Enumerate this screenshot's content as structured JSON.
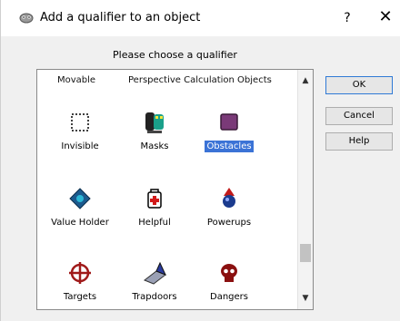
{
  "window": {
    "title": "Add a qualifier to an object",
    "help_glyph": "?",
    "close_glyph": "✕"
  },
  "prompt": "Please choose a qualifier",
  "list": {
    "headers": [
      "Movable",
      "Perspective Calculation Objects"
    ],
    "items": [
      {
        "label": "Invisible",
        "icon": "dotted-square-icon",
        "selected": false
      },
      {
        "label": "Masks",
        "icon": "masks-icon",
        "selected": false
      },
      {
        "label": "Obstacles",
        "icon": "obstacle-box-icon",
        "selected": true
      },
      {
        "label": "Value Holder",
        "icon": "value-holder-icon",
        "selected": false
      },
      {
        "label": "Helpful",
        "icon": "first-aid-icon",
        "selected": false
      },
      {
        "label": "Powerups",
        "icon": "powerup-icon",
        "selected": false
      },
      {
        "label": "Targets",
        "icon": "crosshair-icon",
        "selected": false
      },
      {
        "label": "Trapdoors",
        "icon": "trapdoor-icon",
        "selected": false
      },
      {
        "label": "Dangers",
        "icon": "danger-skull-icon",
        "selected": false
      }
    ]
  },
  "scrollbar": {
    "up_glyph": "▲",
    "down_glyph": "▼"
  },
  "buttons": {
    "ok": "OK",
    "cancel": "Cancel",
    "help": "Help"
  },
  "colors": {
    "selection": "#3b73d6",
    "dialog_bg": "#f0f0f0"
  }
}
